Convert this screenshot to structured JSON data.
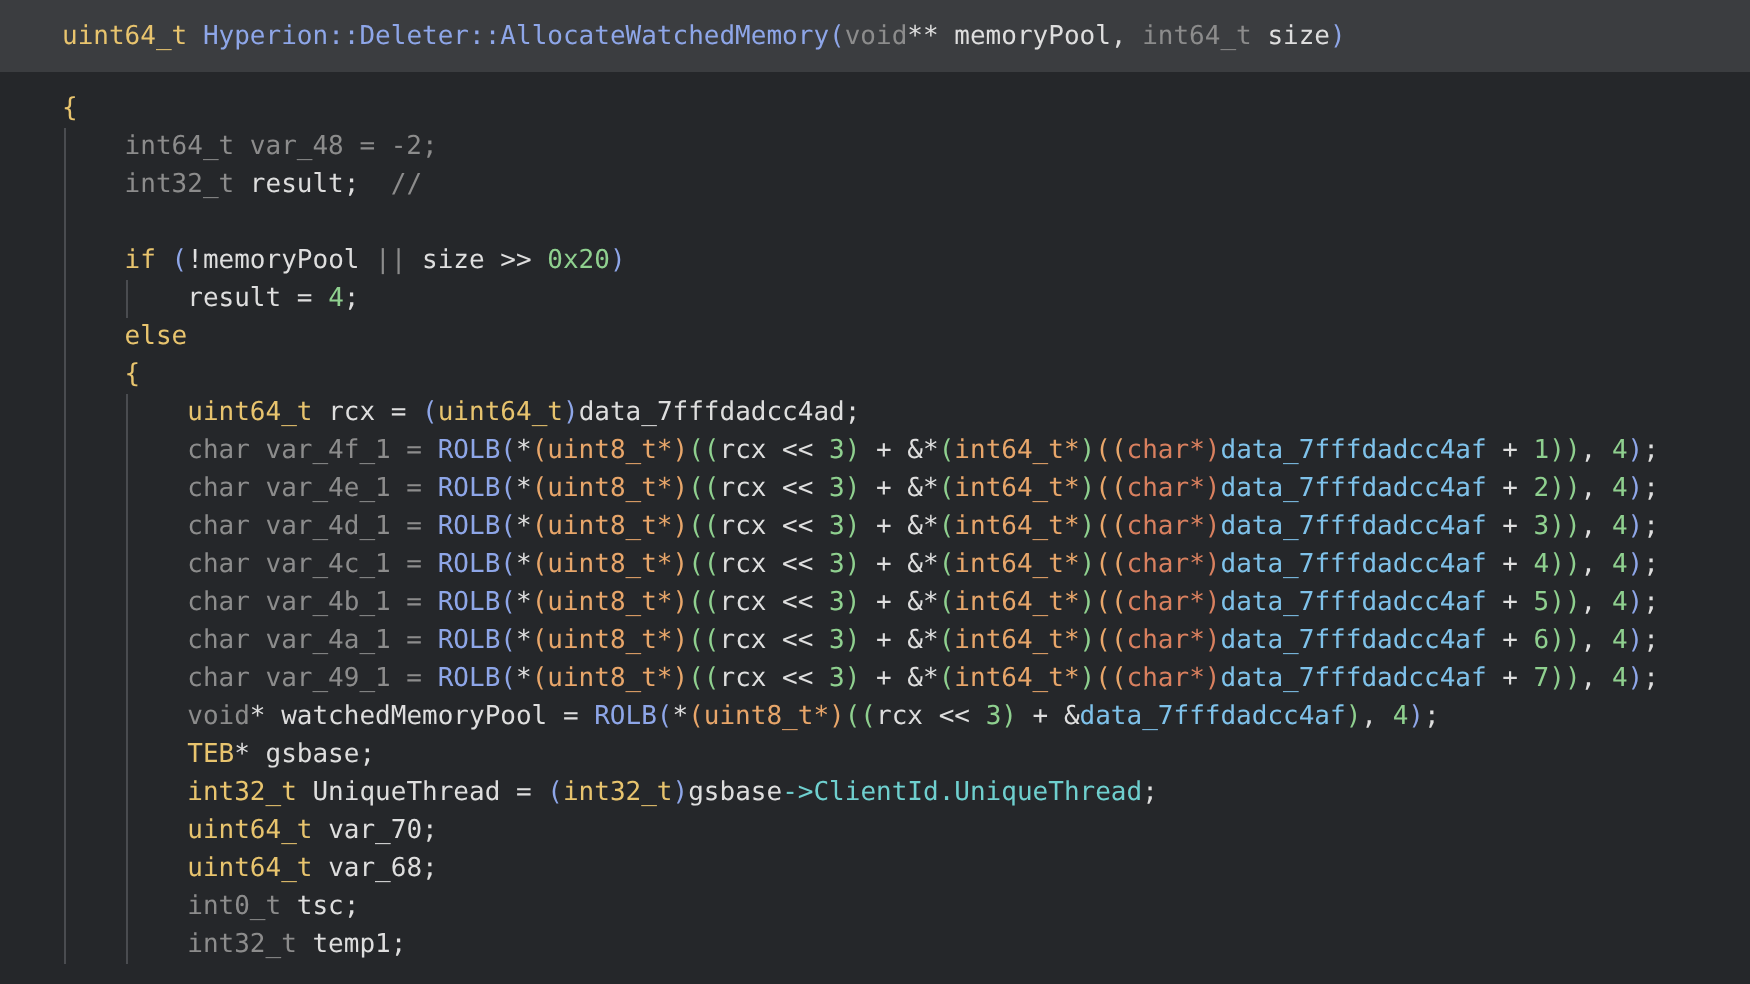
{
  "signature": {
    "tokens": [
      {
        "kind": "type",
        "text": "uint64_t "
      },
      {
        "kind": "func",
        "text": "Hyperion::Deleter::AllocateWatchedMemory"
      },
      {
        "kind": "func",
        "text": "("
      },
      {
        "kind": "muted",
        "text": "void"
      },
      {
        "kind": "ident",
        "text": "** memoryPool, "
      },
      {
        "kind": "muted",
        "text": "int64_t "
      },
      {
        "kind": "ident",
        "text": "size"
      },
      {
        "kind": "func",
        "text": ")"
      }
    ]
  },
  "lines": [
    {
      "kind": "code",
      "tokens": [
        {
          "kind": "type",
          "text": "{"
        }
      ]
    },
    {
      "kind": "code",
      "tokens": [
        {
          "kind": "muted",
          "text": "    int64_t var_48 = -2;"
        }
      ]
    },
    {
      "kind": "code",
      "tokens": [
        {
          "kind": "muted",
          "text": "    int32_t "
        },
        {
          "kind": "ident",
          "text": "result;"
        },
        {
          "kind": "muted",
          "text": "  //"
        }
      ]
    },
    {
      "kind": "blank"
    },
    {
      "kind": "code",
      "tokens": [
        {
          "kind": "type",
          "text": "    if "
        },
        {
          "kind": "func",
          "text": "("
        },
        {
          "kind": "ident",
          "text": "!memoryPool "
        },
        {
          "kind": "muted",
          "text": "||"
        },
        {
          "kind": "ident",
          "text": " size >> "
        },
        {
          "kind": "num",
          "text": "0x20"
        },
        {
          "kind": "func",
          "text": ")"
        }
      ]
    },
    {
      "kind": "code",
      "tokens": [
        {
          "kind": "ident",
          "text": "        result = "
        },
        {
          "kind": "num",
          "text": "4"
        },
        {
          "kind": "ident",
          "text": ";"
        }
      ]
    },
    {
      "kind": "code",
      "tokens": [
        {
          "kind": "type",
          "text": "    else"
        }
      ]
    },
    {
      "kind": "code",
      "tokens": [
        {
          "kind": "type",
          "text": "    {"
        }
      ]
    },
    {
      "kind": "code",
      "tokens": [
        {
          "kind": "type",
          "text": "        uint64_t "
        },
        {
          "kind": "ident",
          "text": "rcx = "
        },
        {
          "kind": "func",
          "text": "("
        },
        {
          "kind": "type",
          "text": "uint64_t"
        },
        {
          "kind": "func",
          "text": ")"
        },
        {
          "kind": "ident",
          "text": "data_7fffdadcc4ad;"
        }
      ]
    },
    {
      "kind": "code",
      "tokens": [
        {
          "kind": "muted",
          "text": "        char var_4f_1 = "
        },
        {
          "kind": "func",
          "text": "ROLB("
        },
        {
          "kind": "ident",
          "text": "*"
        },
        {
          "kind": "cast",
          "text": "(uint8_t*)"
        },
        {
          "kind": "num",
          "text": "(("
        },
        {
          "kind": "ident",
          "text": "rcx << "
        },
        {
          "kind": "num",
          "text": "3)"
        },
        {
          "kind": "ident",
          "text": " + &*"
        },
        {
          "kind": "num",
          "text": "("
        },
        {
          "kind": "cast",
          "text": "int64_t*"
        },
        {
          "kind": "num",
          "text": ")"
        },
        {
          "kind": "cast",
          "text": "(("
        },
        {
          "kind": "castalt",
          "text": "char*)"
        },
        {
          "kind": "data",
          "text": "data_7fffdadcc4af"
        },
        {
          "kind": "ident",
          "text": " + "
        },
        {
          "kind": "num",
          "text": "1))"
        },
        {
          "kind": "ident",
          "text": ", "
        },
        {
          "kind": "num",
          "text": "4"
        },
        {
          "kind": "func",
          "text": ")"
        },
        {
          "kind": "ident",
          "text": ";"
        }
      ]
    },
    {
      "kind": "code",
      "tokens": [
        {
          "kind": "muted",
          "text": "        char var_4e_1 = "
        },
        {
          "kind": "func",
          "text": "ROLB("
        },
        {
          "kind": "ident",
          "text": "*"
        },
        {
          "kind": "cast",
          "text": "(uint8_t*)"
        },
        {
          "kind": "num",
          "text": "(("
        },
        {
          "kind": "ident",
          "text": "rcx << "
        },
        {
          "kind": "num",
          "text": "3)"
        },
        {
          "kind": "ident",
          "text": " + &*"
        },
        {
          "kind": "num",
          "text": "("
        },
        {
          "kind": "cast",
          "text": "int64_t*"
        },
        {
          "kind": "num",
          "text": ")"
        },
        {
          "kind": "cast",
          "text": "(("
        },
        {
          "kind": "castalt",
          "text": "char*)"
        },
        {
          "kind": "data",
          "text": "data_7fffdadcc4af"
        },
        {
          "kind": "ident",
          "text": " + "
        },
        {
          "kind": "num",
          "text": "2))"
        },
        {
          "kind": "ident",
          "text": ", "
        },
        {
          "kind": "num",
          "text": "4"
        },
        {
          "kind": "func",
          "text": ")"
        },
        {
          "kind": "ident",
          "text": ";"
        }
      ]
    },
    {
      "kind": "code",
      "tokens": [
        {
          "kind": "muted",
          "text": "        char var_4d_1 = "
        },
        {
          "kind": "func",
          "text": "ROLB("
        },
        {
          "kind": "ident",
          "text": "*"
        },
        {
          "kind": "cast",
          "text": "(uint8_t*)"
        },
        {
          "kind": "num",
          "text": "(("
        },
        {
          "kind": "ident",
          "text": "rcx << "
        },
        {
          "kind": "num",
          "text": "3)"
        },
        {
          "kind": "ident",
          "text": " + &*"
        },
        {
          "kind": "num",
          "text": "("
        },
        {
          "kind": "cast",
          "text": "int64_t*"
        },
        {
          "kind": "num",
          "text": ")"
        },
        {
          "kind": "cast",
          "text": "(("
        },
        {
          "kind": "castalt",
          "text": "char*)"
        },
        {
          "kind": "data",
          "text": "data_7fffdadcc4af"
        },
        {
          "kind": "ident",
          "text": " + "
        },
        {
          "kind": "num",
          "text": "3))"
        },
        {
          "kind": "ident",
          "text": ", "
        },
        {
          "kind": "num",
          "text": "4"
        },
        {
          "kind": "func",
          "text": ")"
        },
        {
          "kind": "ident",
          "text": ";"
        }
      ]
    },
    {
      "kind": "code",
      "tokens": [
        {
          "kind": "muted",
          "text": "        char var_4c_1 = "
        },
        {
          "kind": "func",
          "text": "ROLB("
        },
        {
          "kind": "ident",
          "text": "*"
        },
        {
          "kind": "cast",
          "text": "(uint8_t*)"
        },
        {
          "kind": "num",
          "text": "(("
        },
        {
          "kind": "ident",
          "text": "rcx << "
        },
        {
          "kind": "num",
          "text": "3)"
        },
        {
          "kind": "ident",
          "text": " + &*"
        },
        {
          "kind": "num",
          "text": "("
        },
        {
          "kind": "cast",
          "text": "int64_t*"
        },
        {
          "kind": "num",
          "text": ")"
        },
        {
          "kind": "cast",
          "text": "(("
        },
        {
          "kind": "castalt",
          "text": "char*)"
        },
        {
          "kind": "data",
          "text": "data_7fffdadcc4af"
        },
        {
          "kind": "ident",
          "text": " + "
        },
        {
          "kind": "num",
          "text": "4))"
        },
        {
          "kind": "ident",
          "text": ", "
        },
        {
          "kind": "num",
          "text": "4"
        },
        {
          "kind": "func",
          "text": ")"
        },
        {
          "kind": "ident",
          "text": ";"
        }
      ]
    },
    {
      "kind": "code",
      "tokens": [
        {
          "kind": "muted",
          "text": "        char var_4b_1 = "
        },
        {
          "kind": "func",
          "text": "ROLB("
        },
        {
          "kind": "ident",
          "text": "*"
        },
        {
          "kind": "cast",
          "text": "(uint8_t*)"
        },
        {
          "kind": "num",
          "text": "(("
        },
        {
          "kind": "ident",
          "text": "rcx << "
        },
        {
          "kind": "num",
          "text": "3)"
        },
        {
          "kind": "ident",
          "text": " + &*"
        },
        {
          "kind": "num",
          "text": "("
        },
        {
          "kind": "cast",
          "text": "int64_t*"
        },
        {
          "kind": "num",
          "text": ")"
        },
        {
          "kind": "cast",
          "text": "(("
        },
        {
          "kind": "castalt",
          "text": "char*)"
        },
        {
          "kind": "data",
          "text": "data_7fffdadcc4af"
        },
        {
          "kind": "ident",
          "text": " + "
        },
        {
          "kind": "num",
          "text": "5))"
        },
        {
          "kind": "ident",
          "text": ", "
        },
        {
          "kind": "num",
          "text": "4"
        },
        {
          "kind": "func",
          "text": ")"
        },
        {
          "kind": "ident",
          "text": ";"
        }
      ]
    },
    {
      "kind": "code",
      "tokens": [
        {
          "kind": "muted",
          "text": "        char var_4a_1 = "
        },
        {
          "kind": "func",
          "text": "ROLB("
        },
        {
          "kind": "ident",
          "text": "*"
        },
        {
          "kind": "cast",
          "text": "(uint8_t*)"
        },
        {
          "kind": "num",
          "text": "(("
        },
        {
          "kind": "ident",
          "text": "rcx << "
        },
        {
          "kind": "num",
          "text": "3)"
        },
        {
          "kind": "ident",
          "text": " + &*"
        },
        {
          "kind": "num",
          "text": "("
        },
        {
          "kind": "cast",
          "text": "int64_t*"
        },
        {
          "kind": "num",
          "text": ")"
        },
        {
          "kind": "cast",
          "text": "(("
        },
        {
          "kind": "castalt",
          "text": "char*)"
        },
        {
          "kind": "data",
          "text": "data_7fffdadcc4af"
        },
        {
          "kind": "ident",
          "text": " + "
        },
        {
          "kind": "num",
          "text": "6))"
        },
        {
          "kind": "ident",
          "text": ", "
        },
        {
          "kind": "num",
          "text": "4"
        },
        {
          "kind": "func",
          "text": ")"
        },
        {
          "kind": "ident",
          "text": ";"
        }
      ]
    },
    {
      "kind": "code",
      "tokens": [
        {
          "kind": "muted",
          "text": "        char var_49_1 = "
        },
        {
          "kind": "func",
          "text": "ROLB("
        },
        {
          "kind": "ident",
          "text": "*"
        },
        {
          "kind": "cast",
          "text": "(uint8_t*)"
        },
        {
          "kind": "num",
          "text": "(("
        },
        {
          "kind": "ident",
          "text": "rcx << "
        },
        {
          "kind": "num",
          "text": "3)"
        },
        {
          "kind": "ident",
          "text": " + &*"
        },
        {
          "kind": "num",
          "text": "("
        },
        {
          "kind": "cast",
          "text": "int64_t*"
        },
        {
          "kind": "num",
          "text": ")"
        },
        {
          "kind": "cast",
          "text": "(("
        },
        {
          "kind": "castalt",
          "text": "char*)"
        },
        {
          "kind": "data",
          "text": "data_7fffdadcc4af"
        },
        {
          "kind": "ident",
          "text": " + "
        },
        {
          "kind": "num",
          "text": "7))"
        },
        {
          "kind": "ident",
          "text": ", "
        },
        {
          "kind": "num",
          "text": "4"
        },
        {
          "kind": "func",
          "text": ")"
        },
        {
          "kind": "ident",
          "text": ";"
        }
      ]
    },
    {
      "kind": "code",
      "tokens": [
        {
          "kind": "muted",
          "text": "        void"
        },
        {
          "kind": "ident",
          "text": "* watchedMemoryPool = "
        },
        {
          "kind": "func",
          "text": "ROLB("
        },
        {
          "kind": "ident",
          "text": "*"
        },
        {
          "kind": "cast",
          "text": "(uint8_t*)"
        },
        {
          "kind": "num",
          "text": "(("
        },
        {
          "kind": "ident",
          "text": "rcx << "
        },
        {
          "kind": "num",
          "text": "3)"
        },
        {
          "kind": "ident",
          "text": " + &"
        },
        {
          "kind": "data",
          "text": "data_7fffdadcc4af"
        },
        {
          "kind": "num",
          "text": ")"
        },
        {
          "kind": "ident",
          "text": ", "
        },
        {
          "kind": "num",
          "text": "4"
        },
        {
          "kind": "func",
          "text": ")"
        },
        {
          "kind": "ident",
          "text": ";"
        }
      ]
    },
    {
      "kind": "code",
      "tokens": [
        {
          "kind": "type",
          "text": "        TEB"
        },
        {
          "kind": "ident",
          "text": "* gsbase;"
        }
      ]
    },
    {
      "kind": "code",
      "tokens": [
        {
          "kind": "type",
          "text": "        int32_t "
        },
        {
          "kind": "ident",
          "text": "UniqueThread = "
        },
        {
          "kind": "func",
          "text": "("
        },
        {
          "kind": "type",
          "text": "int32_t"
        },
        {
          "kind": "func",
          "text": ")"
        },
        {
          "kind": "ident",
          "text": "gsbase"
        },
        {
          "kind": "member",
          "text": "->ClientId.UniqueThread"
        },
        {
          "kind": "ident",
          "text": ";"
        }
      ]
    },
    {
      "kind": "code",
      "tokens": [
        {
          "kind": "type",
          "text": "        uint64_t "
        },
        {
          "kind": "ident",
          "text": "var_70;"
        }
      ]
    },
    {
      "kind": "code",
      "tokens": [
        {
          "kind": "type",
          "text": "        uint64_t "
        },
        {
          "kind": "ident",
          "text": "var_68;"
        }
      ]
    },
    {
      "kind": "code",
      "tokens": [
        {
          "kind": "muted",
          "text": "        int0_t "
        },
        {
          "kind": "ident",
          "text": "tsc;"
        }
      ]
    },
    {
      "kind": "code",
      "tokens": [
        {
          "kind": "muted",
          "text": "        int32_t "
        },
        {
          "kind": "ident",
          "text": "temp1;"
        }
      ]
    }
  ]
}
